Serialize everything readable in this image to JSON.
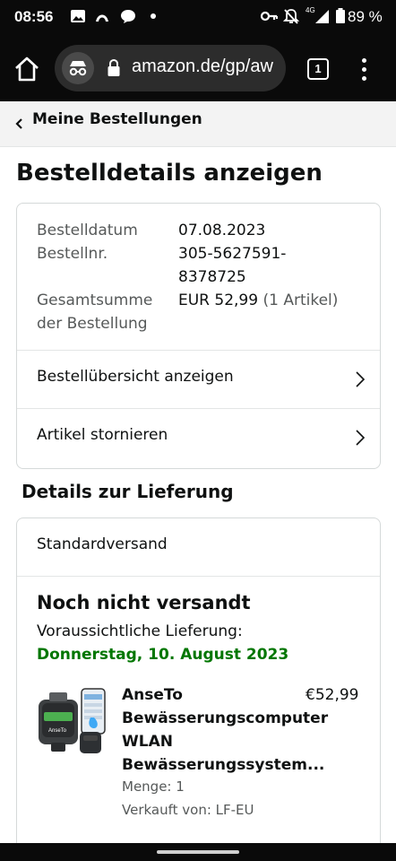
{
  "status_bar": {
    "time": "08:56",
    "battery": "89 %",
    "network": "4G"
  },
  "browser": {
    "url": "amazon.de/gp/aw",
    "tab_count": "1"
  },
  "breadcrumb": {
    "label": "Meine Bestellungen"
  },
  "page_title": "Bestelldetails anzeigen",
  "order_info": {
    "date_label": "Bestelldatum",
    "date_value": "07.08.2023",
    "number_label": "Bestellnr.",
    "number_value_1": "305-5627591-",
    "number_value_2": "8378725",
    "total_label_1": "Gesamtsumme",
    "total_label_2": "der Bestellung",
    "total_value": "EUR 52,99",
    "total_items": "(1 Artikel)"
  },
  "actions": {
    "view_summary": "Bestellübersicht anzeigen",
    "cancel_items": "Artikel stornieren"
  },
  "delivery": {
    "section_title": "Details zur Lieferung",
    "method": "Standardversand",
    "status": "Noch nicht versandt",
    "expected_label": "Voraussichtliche Lieferung:",
    "expected_date": "Donnerstag, 10. August 2023"
  },
  "product": {
    "title_lines": [
      "AnseTo",
      "Bewässerungscomputer",
      "WLAN",
      "Bewässerungssystem..."
    ],
    "price": "€52,99",
    "quantity": "Menge: 1",
    "seller": "Verkauft von: LF-EU",
    "image_brand": "AnseTo"
  },
  "colors": {
    "delivery_green": "#007600",
    "muted_text": "#565959",
    "border": "#d5d9d9"
  }
}
